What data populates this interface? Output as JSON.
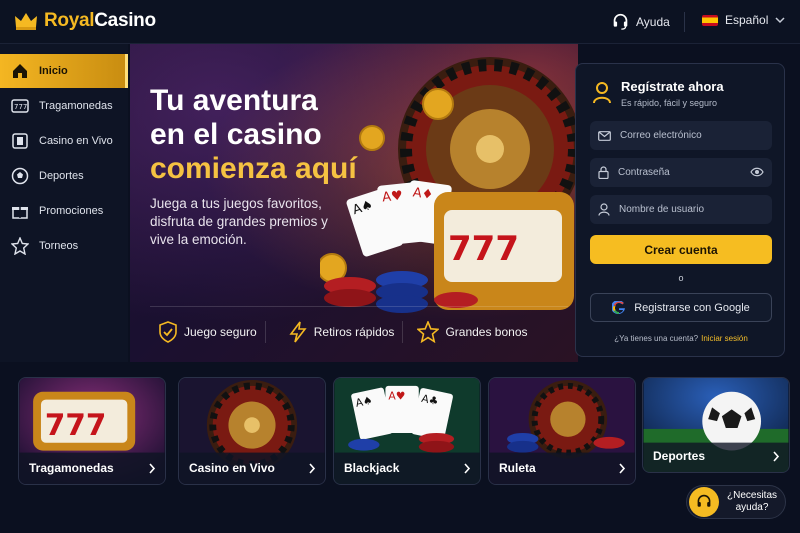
{
  "brand": {
    "name_part1": "Royal",
    "name_part2": "Casino"
  },
  "header": {
    "help": "Ayuda",
    "language": "Español"
  },
  "sidebar": {
    "items": [
      {
        "label": "Inicio",
        "icon": "home-icon",
        "active": true
      },
      {
        "label": "Tragamonedas",
        "icon": "slot-machine-icon",
        "active": false
      },
      {
        "label": "Casino en Vivo",
        "icon": "live-casino-icon",
        "active": false
      },
      {
        "label": "Deportes",
        "icon": "soccer-ball-icon",
        "active": false
      },
      {
        "label": "Promociones",
        "icon": "gift-icon",
        "active": false
      },
      {
        "label": "Torneos",
        "icon": "star-icon",
        "active": false
      }
    ]
  },
  "hero": {
    "title_line1": "Tu aventura",
    "title_line2": "en el casino",
    "title_line3": "comienza aquí",
    "subtitle": "Juega a tus juegos favoritos, disfruta de grandes premios y vive la emoción.",
    "features": [
      {
        "label": "Juego seguro",
        "icon": "shield-check-icon"
      },
      {
        "label": "Retiros rápidos",
        "icon": "lightning-icon"
      },
      {
        "label": "Grandes bonos",
        "icon": "star-icon"
      }
    ]
  },
  "register": {
    "title": "Regístrate ahora",
    "subtitle": "Es rápido, fácil y seguro",
    "email_placeholder": "Correo electrónico",
    "password_placeholder": "Contraseña",
    "username_placeholder": "Nombre de usuario",
    "create_button": "Crear cuenta",
    "or": "o",
    "google_button": "Registrarse con Google",
    "login_prompt": "¿Ya tienes una cuenta?",
    "login_link": "Iniciar sesión"
  },
  "categories": [
    {
      "label": "Tragamonedas"
    },
    {
      "label": "Casino en Vivo"
    },
    {
      "label": "Blackjack"
    },
    {
      "label": "Ruleta"
    },
    {
      "label": "Deportes"
    }
  ],
  "help_bubble": {
    "line1": "¿Necesitas",
    "line2": "ayuda?"
  },
  "colors": {
    "accent": "#f5b922",
    "background": "#0b1020",
    "panel": "#0f1627"
  }
}
